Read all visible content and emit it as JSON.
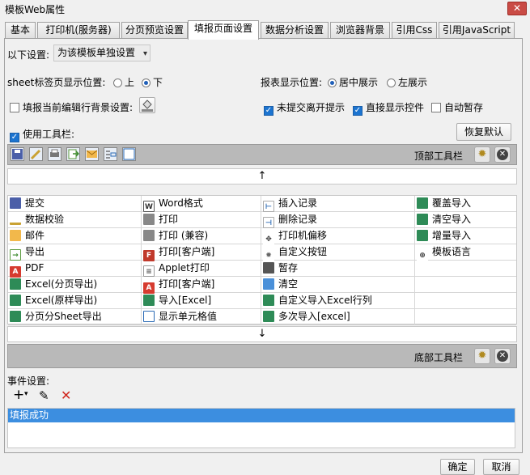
{
  "window": {
    "title": "模板Web属性",
    "close": "✕"
  },
  "tabs": [
    {
      "label": "基本"
    },
    {
      "label": "打印机(服务器)"
    },
    {
      "label": "分页预览设置"
    },
    {
      "label": "填报页面设置"
    },
    {
      "label": "数据分析设置"
    },
    {
      "label": "浏览器背景"
    },
    {
      "label": "引用Css"
    },
    {
      "label": "引用JavaScript"
    }
  ],
  "settings": {
    "scope_label": "以下设置:",
    "scope_value": "为该模板单独设置",
    "sheet_pos_label": "sheet标签页显示位置:",
    "sheet_pos_top": "上",
    "sheet_pos_bottom": "下",
    "report_pos_label": "报表显示位置:",
    "report_pos_center": "居中展示",
    "report_pos_left": "左展示",
    "row_bg_label": "填报当前编辑行背景设置:",
    "unsubmitted_label": "未提交离开提示",
    "show_controls_label": "直接显示控件",
    "autosave_label": "自动暂存",
    "use_toolbar_label": "使用工具栏:",
    "restore_default": "恢复默认"
  },
  "top_toolbar": {
    "label": "顶部工具栏"
  },
  "bottom_toolbar": {
    "label": "底部工具栏"
  },
  "arrows": {
    "up": "↑",
    "down": "↓"
  },
  "columns": [
    [
      "提交",
      "数据校验",
      "邮件",
      "导出",
      "PDF",
      "Excel(分页导出)",
      "Excel(原样导出)",
      "分页分Sheet导出"
    ],
    [
      "Word格式",
      "打印",
      "打印 (兼容)",
      "打印[客户端]",
      "Applet打印",
      "打印[客户端]",
      "导入[Excel]",
      "显示单元格值"
    ],
    [
      "插入记录",
      "删除记录",
      "打印机偏移",
      "自定义按钮",
      "暂存",
      "清空",
      "自定义导入Excel行列",
      "多次导入[excel]"
    ],
    [
      "覆盖导入",
      "清空导入",
      "增量导入",
      "模板语言",
      "",
      "",
      "",
      ""
    ]
  ],
  "events": {
    "label": "事件设置:",
    "add": "+",
    "add_caret": "▾",
    "edit": "✎",
    "delete": "✕",
    "items": [
      "填报成功"
    ]
  },
  "footer": {
    "ok": "确定",
    "cancel": "取消"
  },
  "colors": {
    "accent": "#3c8ee0",
    "strip": "#b9b9b9",
    "check": "#1c74d0"
  }
}
